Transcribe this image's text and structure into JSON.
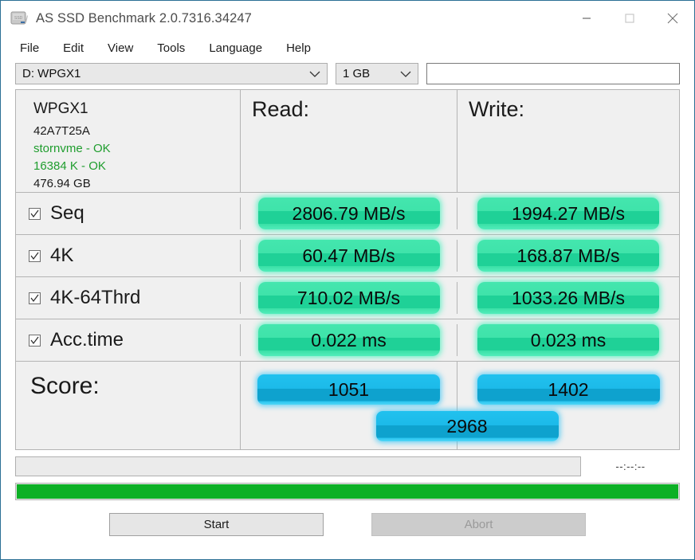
{
  "window": {
    "title": "AS SSD Benchmark 2.0.7316.34247",
    "app_icon": "ssd-drive-icon",
    "minimize_icon": "minimize-icon",
    "maximize_icon": "maximize-icon",
    "close_icon": "close-icon",
    "frame_color": "#2b6f94"
  },
  "menu": {
    "items": [
      {
        "label": "File"
      },
      {
        "label": "Edit"
      },
      {
        "label": "View"
      },
      {
        "label": "Tools"
      },
      {
        "label": "Language"
      },
      {
        "label": "Help"
      }
    ]
  },
  "toolbar": {
    "drive_select": {
      "value": "D: WPGX1",
      "chevron_icon": "chevron-down-icon"
    },
    "size_select": {
      "value": "1 GB",
      "chevron_icon": "chevron-down-icon"
    },
    "info_field": {
      "value": "",
      "placeholder": ""
    }
  },
  "drive_info": {
    "name": "WPGX1",
    "firmware": "42A7T25A",
    "driver": "stornvme - OK",
    "alignment": "16384 K - OK",
    "capacity": "476.94 GB",
    "ok_color": "#1f9d2e"
  },
  "columns": {
    "read_header": "Read:",
    "write_header": "Write:"
  },
  "results": {
    "rows": [
      {
        "label": "Seq",
        "checked": true,
        "read": "2806.79 MB/s",
        "write": "1994.27 MB/s"
      },
      {
        "label": "4K",
        "checked": true,
        "read": "60.47 MB/s",
        "write": "168.87 MB/s"
      },
      {
        "label": "4K-64Thrd",
        "checked": true,
        "read": "710.02 MB/s",
        "write": "1033.26 MB/s"
      },
      {
        "label": "Acc.time",
        "checked": true,
        "read": "0.022 ms",
        "write": "0.023 ms"
      }
    ],
    "pill_color_green": "#1fd197",
    "pill_color_blue": "#0ea2ce"
  },
  "score": {
    "label": "Score:",
    "read": "1051",
    "write": "1402",
    "total": "2968"
  },
  "status": {
    "message": "",
    "timer": "--:--:--",
    "progress_percent": 100,
    "progress_color": "#0cb025"
  },
  "actions": {
    "start_label": "Start",
    "abort_label": "Abort"
  }
}
